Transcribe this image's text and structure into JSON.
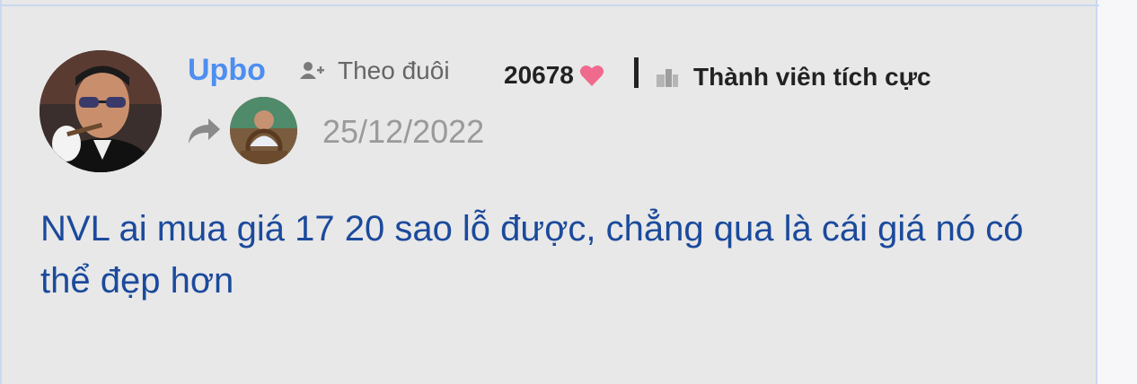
{
  "post": {
    "author": {
      "name": "Upbo",
      "avatar_icon": "user-avatar",
      "follow_label": "Theo đuôi",
      "points": "20678",
      "rank": "Thành viên tích cực"
    },
    "shared_from_avatar_icon": "shared-user-avatar",
    "date": "25/12/2022",
    "content": "NVL ai mua giá 17 20 sao lỗ được, chẳng qua là cái giá nó có thể đẹp hơn"
  },
  "colors": {
    "username": "#4d8ef0",
    "content": "#1b4a9c",
    "heart": "#f06a8e",
    "card_background": "#e8e8e8"
  }
}
